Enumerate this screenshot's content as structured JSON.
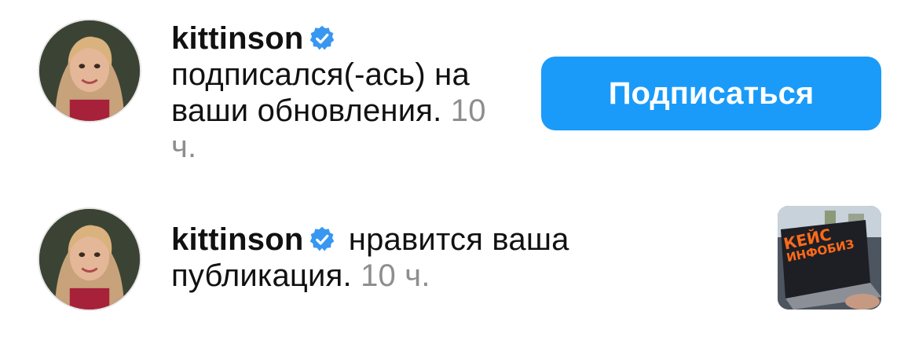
{
  "notifications": [
    {
      "username": "kittinson",
      "verified": true,
      "message": "подписался(-ась) на ваши обновления.",
      "time": "10 ч.",
      "action_button": "Подписаться"
    },
    {
      "username": "kittinson",
      "verified": true,
      "message": "нравится ваша публикация.",
      "time": "10 ч.",
      "post_thumbnail": {
        "line1": "КЕЙС",
        "line2": "ИНФОБИЗ"
      }
    }
  ],
  "icons": {
    "verified": "verified-badge-icon"
  },
  "colors": {
    "accent": "#1a9bf9",
    "verified": "#3897f0",
    "secondary_text": "#8e8e8e",
    "thumbnail_text": "#ff6a1a"
  }
}
